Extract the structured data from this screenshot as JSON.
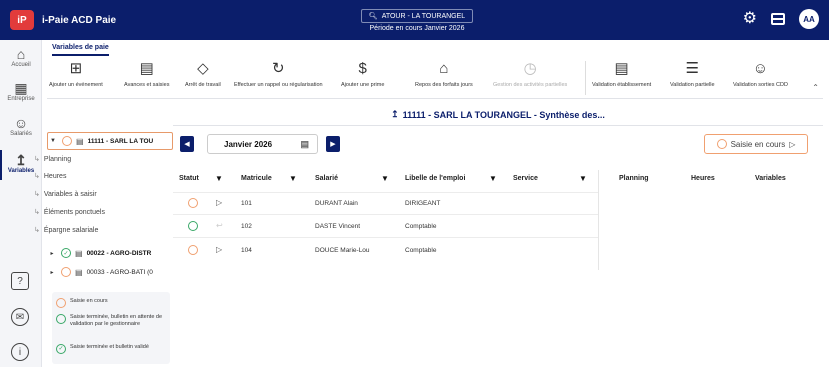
{
  "app": {
    "logo": "iP",
    "title": "i-Paie ACD Paie",
    "search": "ATOUR - LA TOURANGEL",
    "period": "Période en cours Janvier 2026",
    "avatar": "AA"
  },
  "nav": [
    {
      "label": "Accueil",
      "icon": "home-icon"
    },
    {
      "label": "Entreprise",
      "icon": "building-icon"
    },
    {
      "label": "Salariés",
      "icon": "users-icon"
    },
    {
      "label": "Variables",
      "icon": "chart-icon"
    }
  ],
  "tab": "Variables de paie",
  "toolbar": [
    "Ajouter un événement",
    "Avances et saisies",
    "Arrêt de travail",
    "Effectuer un rappel ou régularisation",
    "Ajouter une prime",
    "Repos des forfaits jours",
    "Gestion des activités partielles",
    "Validation établissement",
    "Validation partielle",
    "Validation sorties CDD"
  ],
  "tree": {
    "n1": "11111 - SARL LA TOU",
    "subs": [
      "Planning",
      "Heures",
      "Variables à saisir",
      "Éléments ponctuels",
      "Épargne salariale"
    ],
    "n2": "00022 - AGRO-DISTR",
    "n3": "00033 - AGRO-BATI (0"
  },
  "legend": {
    "l1": "Saisie en cours",
    "l2": "Saisie terminée, bulletin en attente de validation par le gestionnaire",
    "l3": "Saisie terminée et bulletin validé"
  },
  "main": {
    "title": "11111 - SARL LA TOURANGEL - Synthèse des...",
    "month": "Janvier 2026",
    "status": "Saisie en cours"
  },
  "table": {
    "headers": [
      "Statut",
      "Matricule",
      "Salarié",
      "Libelle de l'emploi",
      "Service",
      "Planning",
      "Heures",
      "Variables"
    ],
    "rows": [
      {
        "matricule": "101",
        "salarie": "DURANT Alain",
        "emploi": "DIRIGEANT"
      },
      {
        "matricule": "102",
        "salarie": "DASTE Vincent",
        "emploi": "Comptable"
      },
      {
        "matricule": "104",
        "salarie": "DOUCE Marie-Lou",
        "emploi": "Comptable"
      }
    ]
  },
  "colors": {
    "navy": "#0b1e6b",
    "orange": "#f0a070",
    "green": "#39a867",
    "red": "#e23b3b"
  }
}
